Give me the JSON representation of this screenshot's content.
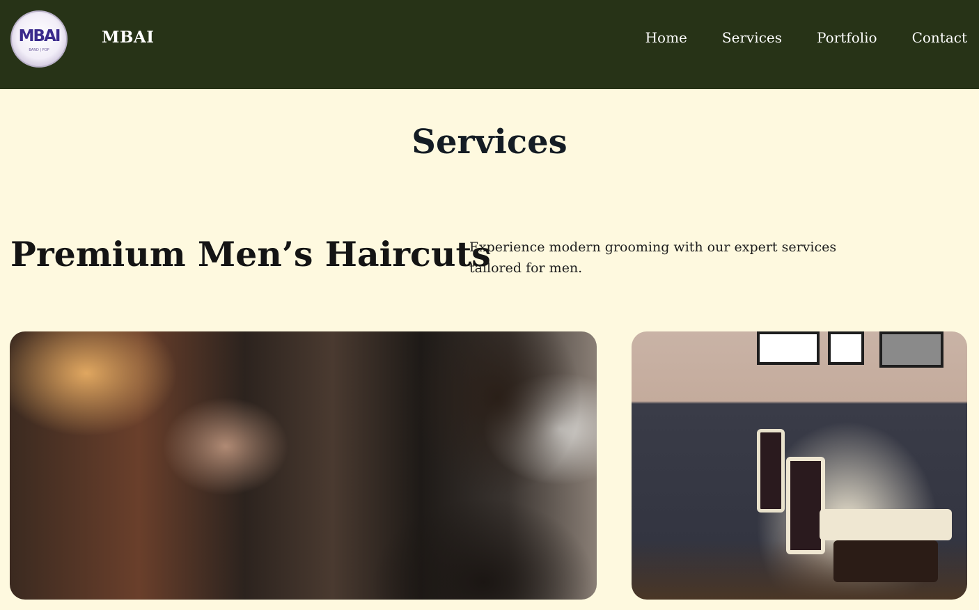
{
  "header": {
    "logo_text": "MBAI",
    "logo_subtext": "BAND | POP",
    "brand": "MBAI",
    "nav": [
      "Home",
      "Services",
      "Portfolio",
      "Contact"
    ]
  },
  "page_title": "Services",
  "hero": {
    "heading": "Premium Men’s Haircuts",
    "description": "Experience modern grooming with our expert services tailored for men."
  },
  "colors": {
    "header_bg": "#273317",
    "page_bg": "#fef9df",
    "text": "#141414"
  }
}
